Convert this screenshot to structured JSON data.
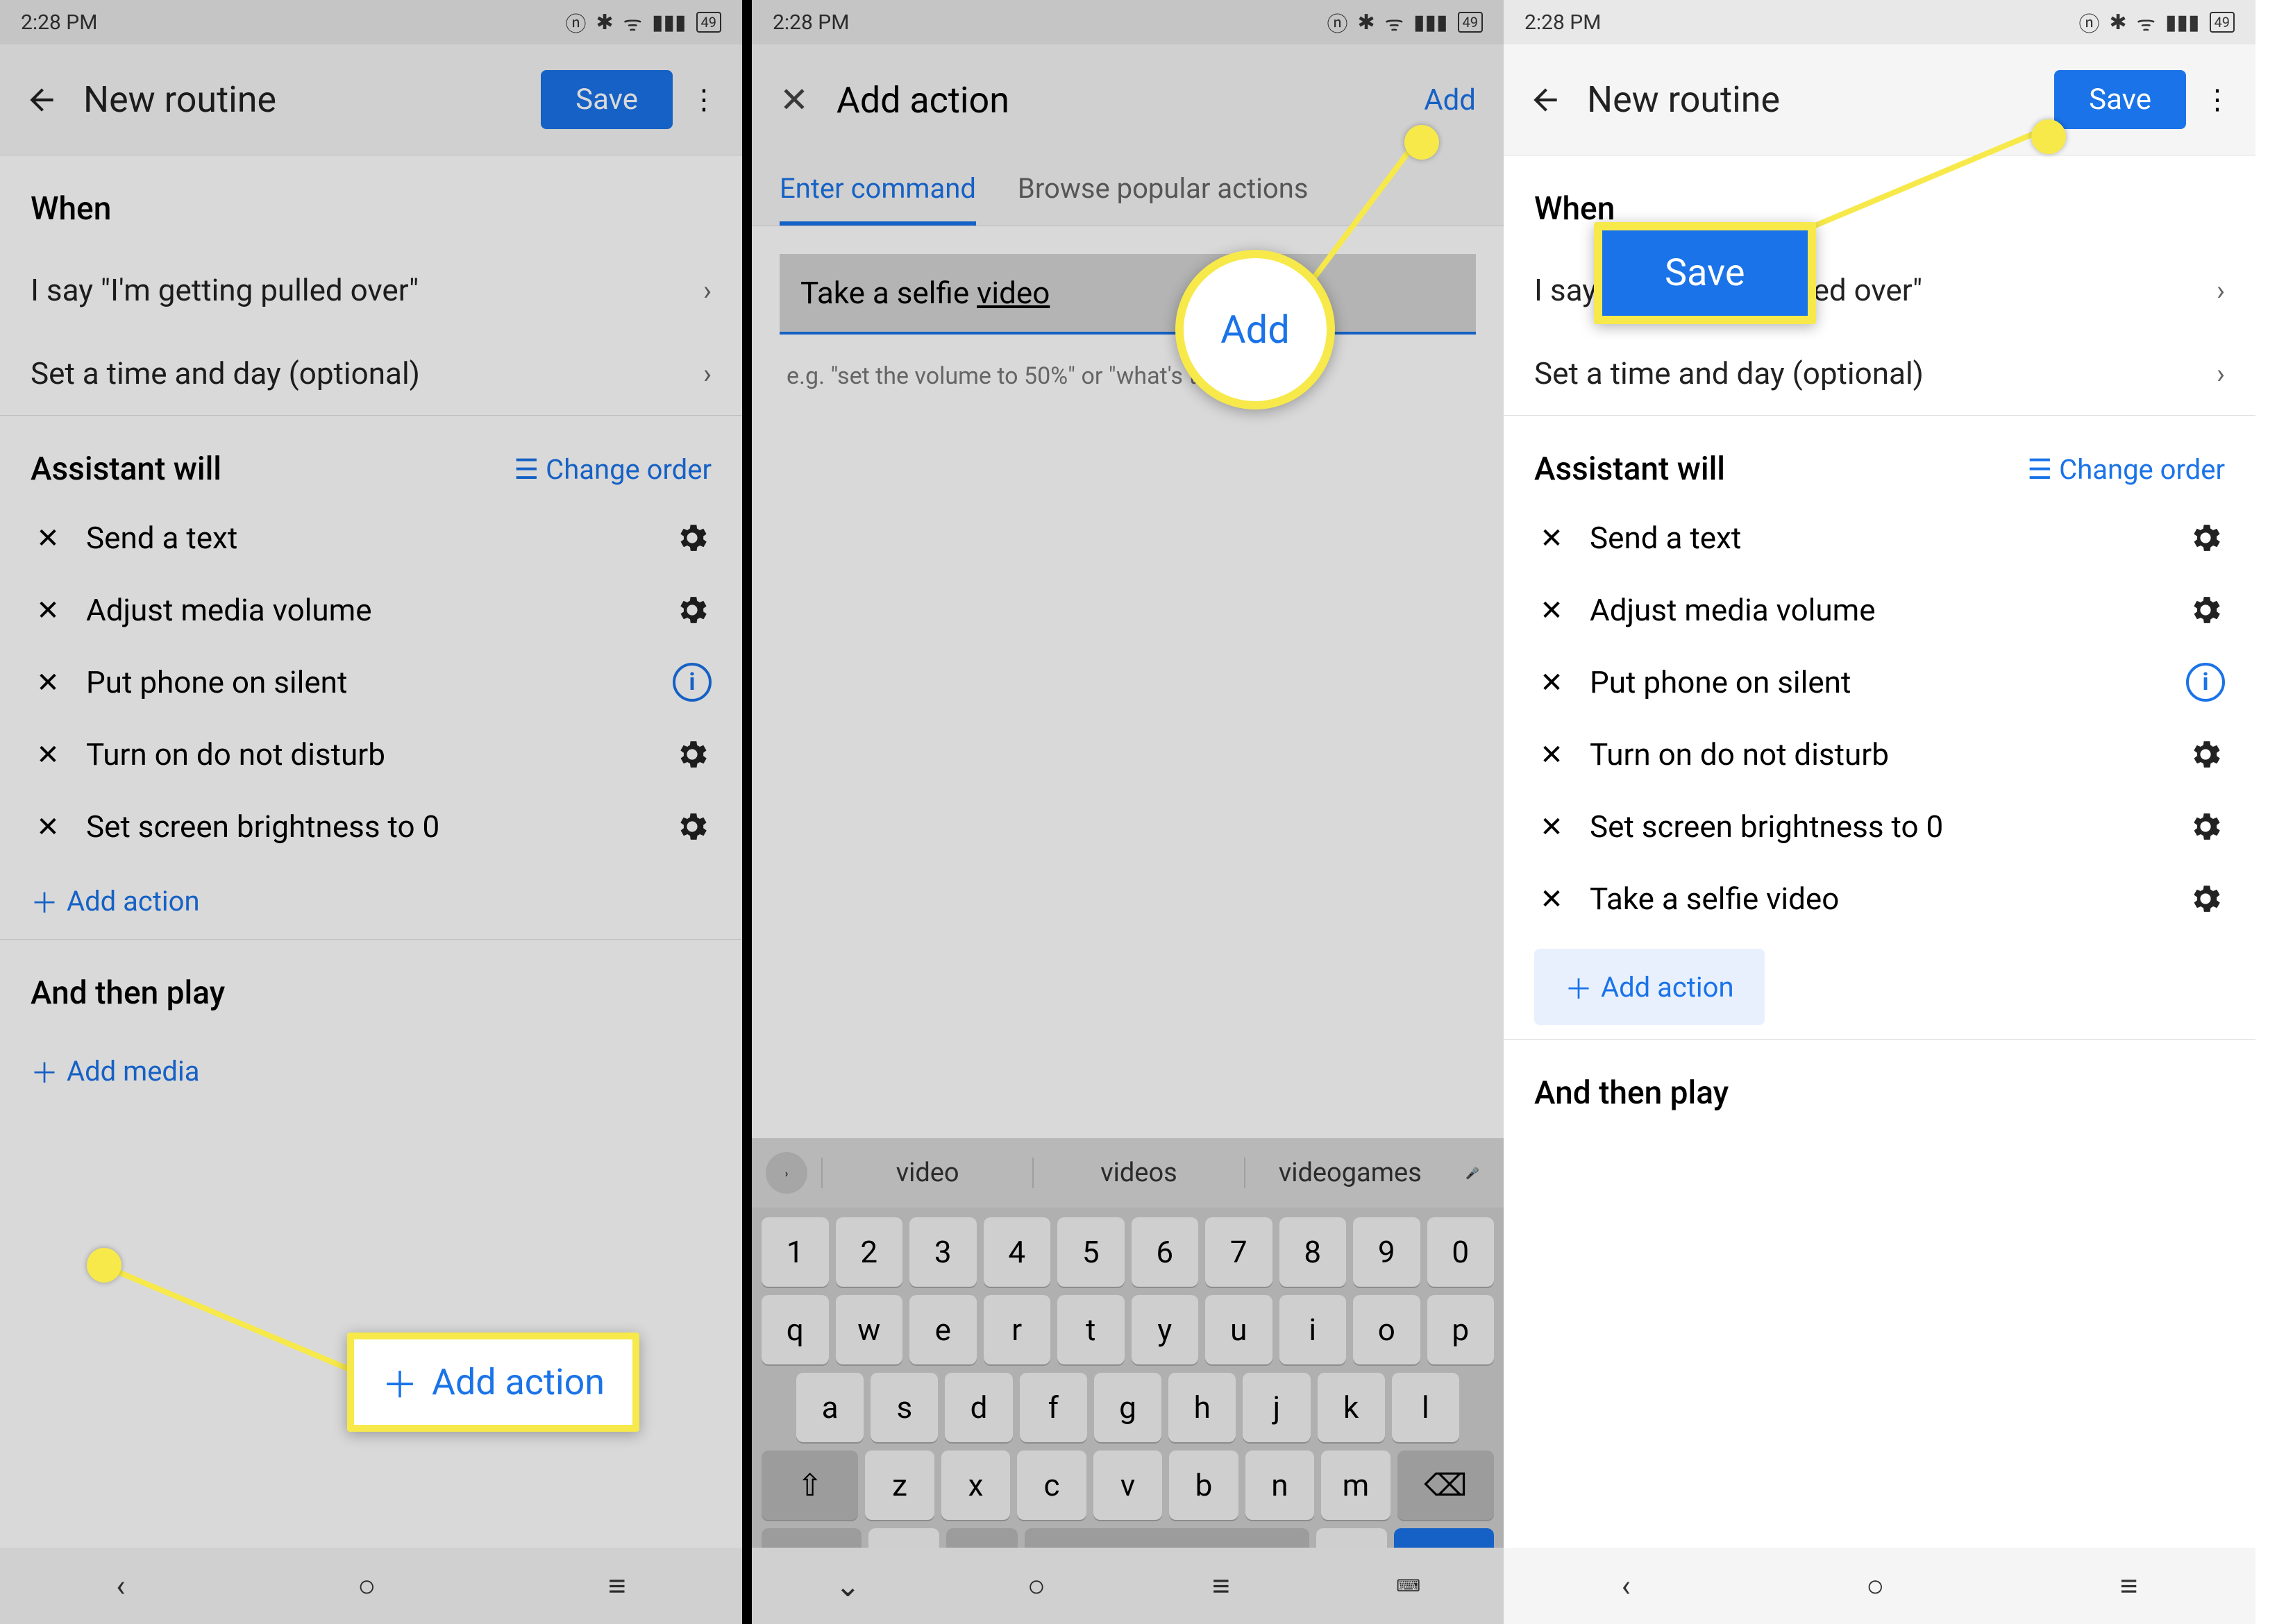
{
  "status": {
    "time": "2:28 PM",
    "battery": "49"
  },
  "panel1": {
    "title": "New routine",
    "save": "Save",
    "when_title": "When",
    "when_row1": "I say \"I'm getting pulled over\"",
    "when_row2": "Set a time and day (optional)",
    "assistant_title": "Assistant will",
    "change_order": "Change order",
    "actions": [
      {
        "label": "Send a text",
        "right": "gear"
      },
      {
        "label": "Adjust media volume",
        "right": "gear"
      },
      {
        "label": "Put phone on silent",
        "right": "info"
      },
      {
        "label": "Turn on do not disturb",
        "right": "gear"
      },
      {
        "label": "Set screen brightness to 0",
        "right": "gear"
      }
    ],
    "add_action": "Add action",
    "then_play": "And then play",
    "add_media": "Add media",
    "callout_add_action": "Add action"
  },
  "panel2": {
    "title": "Add action",
    "add": "Add",
    "tab1": "Enter command",
    "tab2": "Browse popular actions",
    "command_pre": "Take a selfie ",
    "command_uword": "video",
    "hint": "e.g. \"set the volume to 50%\" or \"what's the weather\"",
    "suggestions": [
      "video",
      "videos",
      "videogames"
    ],
    "callout_add": "Add"
  },
  "panel3": {
    "title": "New routine",
    "save": "Save",
    "when_title": "When",
    "when_row1": "I say \"I'm getting pulled over\"",
    "when_row2": "Set a time and day (optional)",
    "assistant_title": "Assistant will",
    "change_order": "Change order",
    "actions": [
      {
        "label": "Send a text",
        "right": "gear"
      },
      {
        "label": "Adjust media volume",
        "right": "gear"
      },
      {
        "label": "Put phone on silent",
        "right": "info"
      },
      {
        "label": "Turn on do not disturb",
        "right": "gear"
      },
      {
        "label": "Set screen brightness to 0",
        "right": "gear"
      },
      {
        "label": "Take a selfie video",
        "right": "gear"
      }
    ],
    "add_action": "Add action",
    "then_play": "And then play",
    "callout_save": "Save"
  }
}
